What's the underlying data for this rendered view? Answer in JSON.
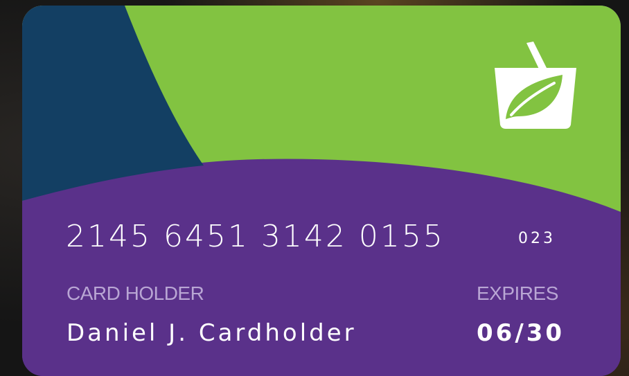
{
  "card": {
    "number": "2145 6451 3142 0155",
    "cvv": "023",
    "holder_label": "CARD HOLDER",
    "holder_name": "Daniel J. Cardholder",
    "expires_label": "EXPIRES",
    "expiry": "06/30",
    "logo_icon": "shopping-basket-leaf-icon",
    "colors": {
      "purple": "#5a318a",
      "green": "#82c341",
      "navy": "#133f63",
      "label": "#b9a6d4",
      "text": "#ffffff"
    }
  }
}
